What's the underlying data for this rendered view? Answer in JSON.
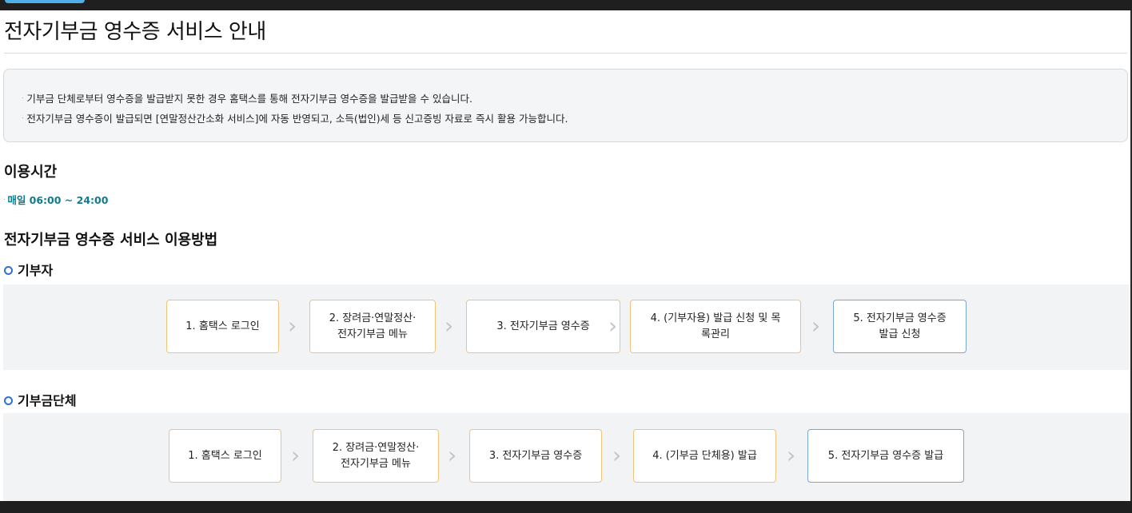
{
  "page_title": "전자기부금 영수증 서비스 안내",
  "notice": {
    "bullet_glyph": "ᐧ",
    "lines": [
      "기부금 단체로부터 영수증을 발급받지 못한 경우 홈택스를 통해 전자기부금 영수증을 발급받을 수 있습니다.",
      "전자기부금 영수증이 발급되면 [연말정산간소화 서비스]에 자동 반영되고, 소득(법인)세 등 신고증빙 자료로 즉시 활용 가능합니다."
    ]
  },
  "hours": {
    "heading": "이용시간",
    "text": "매일 06:00 ~ 24:00"
  },
  "method": {
    "heading": "전자기부금 영수증 서비스 이용방법",
    "donor": {
      "heading": "기부자",
      "steps": [
        "1. 홈택스 로그인",
        "2. 장려금·연말정산·\n전자기부금 메뉴",
        "3. 전자기부금 영수증",
        "4. (기부자용) 발급 신청 및 목\n록관리",
        "5. 전자기부금 영수증\n발급 신청"
      ]
    },
    "org": {
      "heading": "기부금단체",
      "steps": [
        "1. 홈택스 로그인",
        "2. 장려금·연말정산·\n전자기부금 메뉴",
        "3. 전자기부금 영수증",
        "4. (기부금 단체용) 발급",
        "5. 전자기부금 영수증 발급"
      ]
    }
  },
  "colors": {
    "step_border": "#f2c37a",
    "final_border": "#7aa6d6",
    "accent_ring": "#2f6fd6",
    "hours_text": "#117a8b"
  },
  "icons": {
    "step_arrow": "chevron-right-icon",
    "bullet_ring": "ring-bullet-icon"
  }
}
